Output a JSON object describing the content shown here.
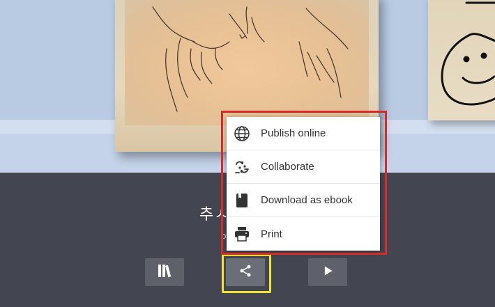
{
  "book": {
    "title": "추ㅅ",
    "subtitle": "ɔ"
  },
  "share_menu": {
    "items": [
      {
        "label": "Publish online",
        "icon": "globe-icon"
      },
      {
        "label": "Collaborate",
        "icon": "collaborate-icon"
      },
      {
        "label": "Download as ebook",
        "icon": "ebook-icon"
      },
      {
        "label": "Print",
        "icon": "printer-icon"
      }
    ]
  },
  "toolbar": {
    "library_icon": "library-icon",
    "share_icon": "share-icon",
    "play_icon": "play-icon"
  },
  "colors": {
    "highlight_menu": "#d62b2b",
    "highlight_button": "#f2e33a",
    "panel_bg": "#434650",
    "scene_bg": "#b9cbe3"
  }
}
